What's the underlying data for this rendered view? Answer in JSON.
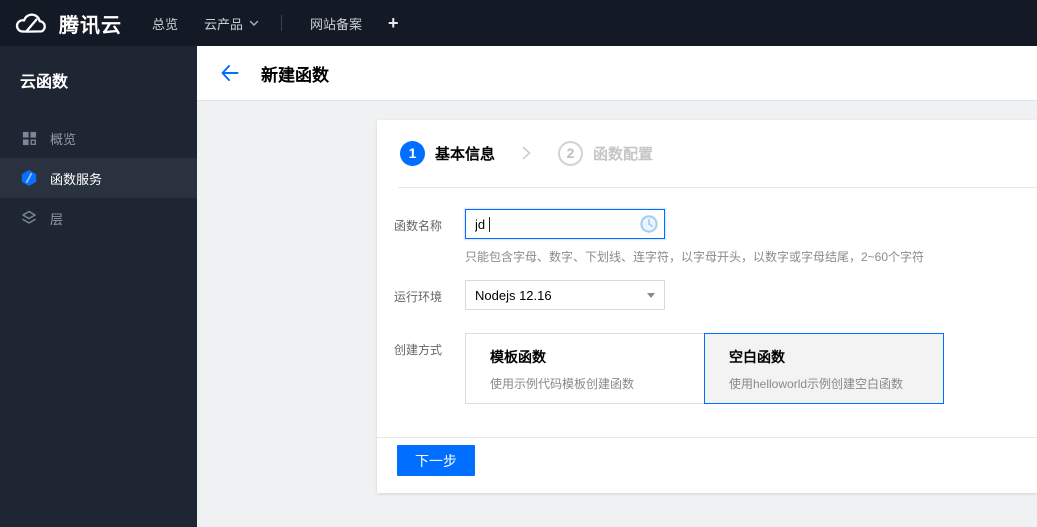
{
  "navbar": {
    "brand": "腾讯云",
    "items": [
      {
        "label": "总览"
      },
      {
        "label": "云产品",
        "has_caret": true
      },
      {
        "label": "网站备案"
      }
    ],
    "plus_label": "+"
  },
  "sidebar": {
    "title": "云函数",
    "items": [
      {
        "label": "概览",
        "icon": "grid-icon",
        "active": false
      },
      {
        "label": "函数服务",
        "icon": "hexagon-function-icon",
        "active": true
      },
      {
        "label": "层",
        "icon": "layers-icon",
        "active": false
      }
    ]
  },
  "header": {
    "title": "新建函数"
  },
  "wizard": {
    "steps": [
      {
        "number": "1",
        "label": "基本信息",
        "active": true
      },
      {
        "number": "2",
        "label": "函数配置",
        "active": false
      }
    ]
  },
  "form": {
    "name": {
      "label": "函数名称",
      "value": "jd",
      "hint": "只能包含字母、数字、下划线、连字符，以字母开头，以数字或字母结尾，2~60个字符"
    },
    "runtime": {
      "label": "运行环境",
      "value": "Nodejs 12.16"
    },
    "creation": {
      "label": "创建方式",
      "options": [
        {
          "title": "模板函数",
          "desc": "使用示例代码模板创建函数",
          "selected": false
        },
        {
          "title": "空白函数",
          "desc": "使用helloworld示例创建空白函数",
          "selected": true
        }
      ]
    }
  },
  "footer": {
    "next_label": "下一步"
  },
  "icons": {
    "cloud-logo-icon": "cloud outline with slash (svg)",
    "grid-icon": "2x2 squares (svg)",
    "hexagon-function-icon": "blue hexagon with slash (svg)",
    "layers-icon": "stacked layers (svg)",
    "back-arrow-icon": "left arrow (svg)",
    "clock-icon": "light blue clock (svg)",
    "caret-down-icon": "small chevron/triangle down",
    "chevron-right-icon": "gray chevron right",
    "plus-icon": "+"
  },
  "colors": {
    "accent": "#006eff",
    "navbar_bg": "#141a25",
    "sidebar_bg": "#1e2633",
    "sidebar_active_bg": "#2a3240",
    "content_bg": "#f0f1f2",
    "selected_card_bg": "#f3f3f4",
    "muted_text": "#888888"
  }
}
